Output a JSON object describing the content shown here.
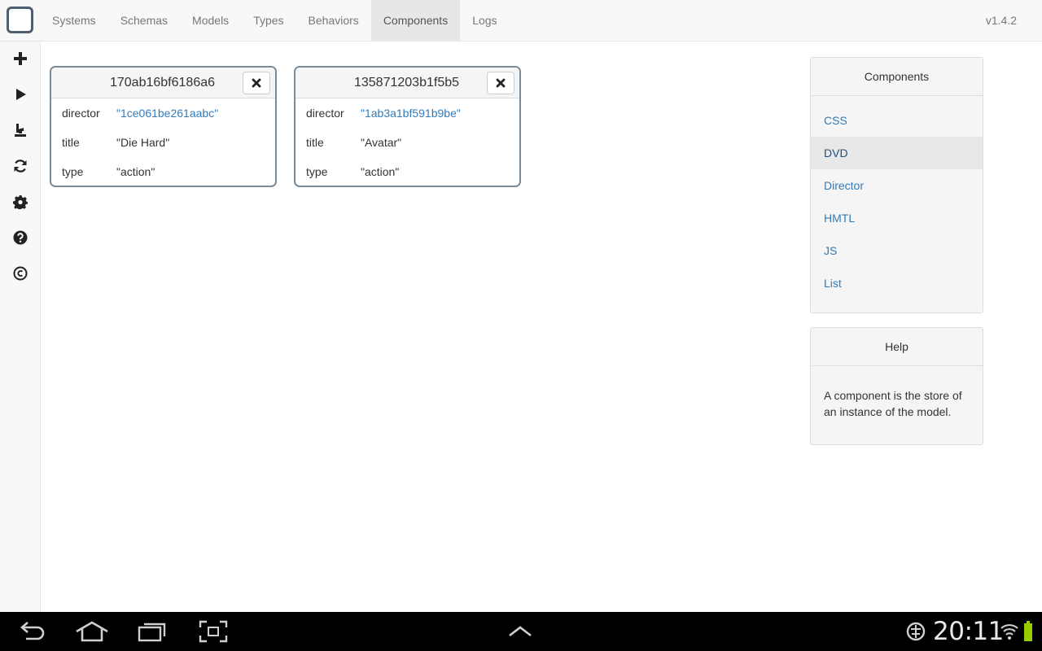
{
  "nav": {
    "items": [
      "Systems",
      "Schemas",
      "Models",
      "Types",
      "Behaviors",
      "Components",
      "Logs"
    ],
    "active": "Components",
    "version": "v1.4.2"
  },
  "sidebar": {
    "icons": [
      "plus-icon",
      "play-icon",
      "eject-download-icon",
      "refresh-icon",
      "gear-icon",
      "question-icon",
      "copyright-icon"
    ]
  },
  "cards": [
    {
      "id": "170ab16bf6186a6",
      "rows": [
        {
          "key": "director",
          "value": "\"1ce061be261aabc\""
        },
        {
          "key": "title",
          "value": "\"Die Hard\""
        },
        {
          "key": "type",
          "value": "\"action\""
        }
      ]
    },
    {
      "id": "135871203b1f5b5",
      "rows": [
        {
          "key": "director",
          "value": "\"1ab3a1bf591b9be\""
        },
        {
          "key": "title",
          "value": "\"Avatar\""
        },
        {
          "key": "type",
          "value": "\"action\""
        }
      ]
    }
  ],
  "components_panel": {
    "title": "Components",
    "items": [
      "CSS",
      "DVD",
      "Director",
      "HMTL",
      "JS",
      "List"
    ],
    "active": "DVD"
  },
  "help_panel": {
    "title": "Help",
    "text": "A component is the store of an instance of the model."
  },
  "status_bar": {
    "time": "20:11"
  },
  "colors": {
    "link": "#337ab7",
    "navbar_bg": "#f8f8f8",
    "card_border": "#7a8a96",
    "battery": "#99cc00"
  }
}
